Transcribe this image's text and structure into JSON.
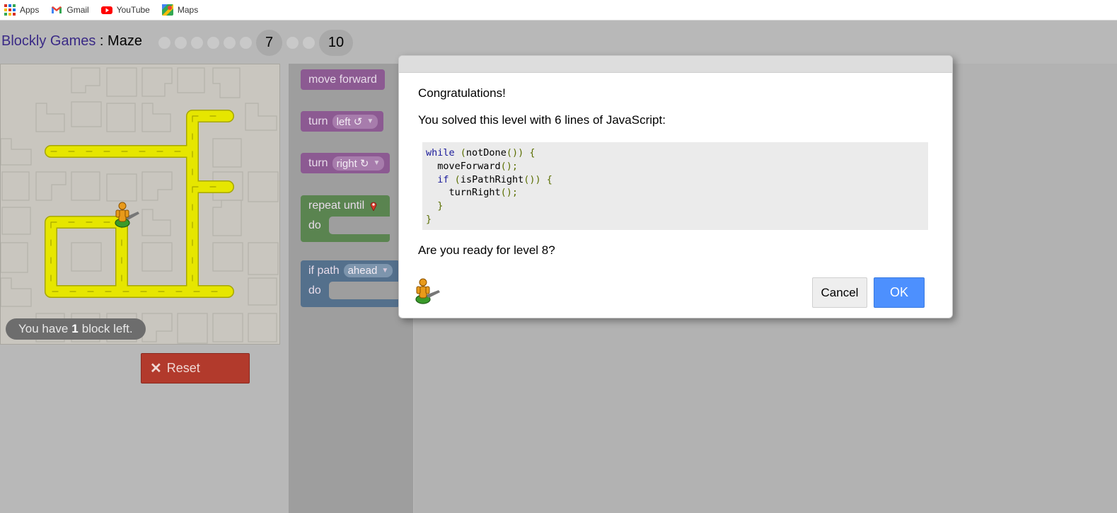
{
  "bookmarks": [
    {
      "label": "Apps",
      "icon": "apps-grid-icon"
    },
    {
      "label": "Gmail",
      "icon": "gmail-icon"
    },
    {
      "label": "YouTube",
      "icon": "youtube-icon"
    },
    {
      "label": "Maps",
      "icon": "maps-icon"
    }
  ],
  "header": {
    "brand": "Blockly Games",
    "separator": " : ",
    "game": "Maze",
    "levels": {
      "current_label": "7",
      "last_label": "10",
      "current": 7,
      "total": 10
    }
  },
  "maze": {
    "blocks_left_prefix": "You have",
    "blocks_left_count": "1",
    "blocks_left_suffix": "block left.",
    "reset_label": "Reset"
  },
  "toolbox": {
    "move_forward": "move forward",
    "turn_label": "turn",
    "left_option": "left ↺",
    "right_option": "right ↻",
    "repeat_until": "repeat until",
    "do_label": "do",
    "if_path": "if path",
    "ahead_option": "ahead"
  },
  "dialog": {
    "congrats": "Congratulations!",
    "solved": "You solved this level with 6 lines of JavaScript:",
    "code_lines": [
      "while (notDone()) {",
      "  moveForward();",
      "  if (isPathRight()) {",
      "    turnRight();",
      "  }",
      "}"
    ],
    "ready": "Are you ready for level 8?",
    "cancel_label": "Cancel",
    "ok_label": "OK"
  },
  "colors": {
    "brand": "#3a2a86",
    "path": "#e6e600",
    "movement_block": "#8c5a92",
    "loop_block": "#5a8450",
    "logic_block": "#54708c",
    "reset": "#b23a2c",
    "ok_button": "#4d90fe"
  }
}
